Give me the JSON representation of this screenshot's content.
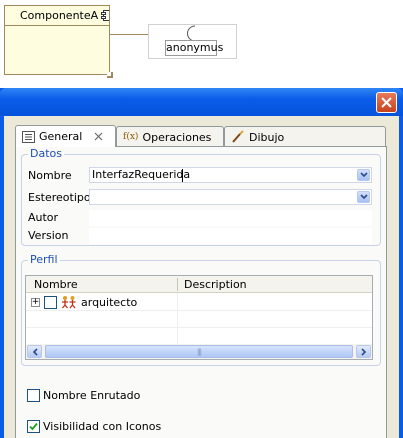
{
  "diagram": {
    "component_name": "ComponenteA",
    "interface_name": "anonymus"
  },
  "dialog": {
    "tabs": [
      {
        "label": "General",
        "icon": "properties-icon",
        "active": true
      },
      {
        "label": "Operaciones",
        "icon": "function-icon",
        "active": false
      },
      {
        "label": "Dibujo",
        "icon": "brush-icon",
        "active": false
      }
    ],
    "datos": {
      "title": "Datos",
      "nombre_label": "Nombre",
      "nombre_value": "InterfazRequerida",
      "estereotipo_label": "Estereotipo",
      "estereotipo_value": "",
      "autor_label": "Autor",
      "autor_value": "",
      "version_label": "Version",
      "version_value": ""
    },
    "perfil": {
      "title": "Perfil",
      "columns": [
        "Nombre",
        "Description"
      ],
      "rows": [
        {
          "name": "arquitecto",
          "description": "",
          "checked": false,
          "expand_symbol": "+"
        }
      ],
      "scroll_thumb_grip": "|||"
    },
    "options": {
      "nombre_enrutado_label": "Nombre Enrutado",
      "nombre_enrutado_checked": false,
      "visibilidad_label": "Visibilidad con Iconos",
      "visibilidad_checked": true
    },
    "colors": {
      "titlebar": "#0a5ce8",
      "close_button": "#c7411e",
      "group_title": "#1f4fb4",
      "component_fill": "#fffde0"
    }
  }
}
